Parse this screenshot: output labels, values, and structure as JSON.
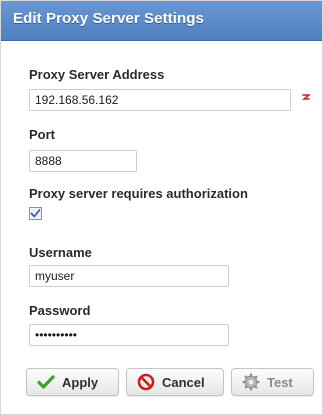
{
  "dialog": {
    "title": "Edit Proxy Server Settings"
  },
  "form": {
    "address_label": "Proxy Server Address",
    "address_value": "192.168.56.162",
    "port_label": "Port",
    "port_value": "8888",
    "auth_label": "Proxy server requires authorization",
    "auth_checked": true,
    "username_label": "Username",
    "username_value": "myuser",
    "password_label": "Password",
    "password_value": "myuser1234"
  },
  "buttons": {
    "apply": "Apply",
    "cancel": "Cancel",
    "test": "Test"
  },
  "icons": {
    "required": "required-marker-icon",
    "apply": "checkmark-icon",
    "cancel": "prohibited-icon",
    "test": "gear-icon"
  },
  "colors": {
    "title_bar": "#5a88c8",
    "apply_check": "#3f9f2f",
    "cancel_icon": "#cc2020",
    "required": "#d0202a"
  }
}
